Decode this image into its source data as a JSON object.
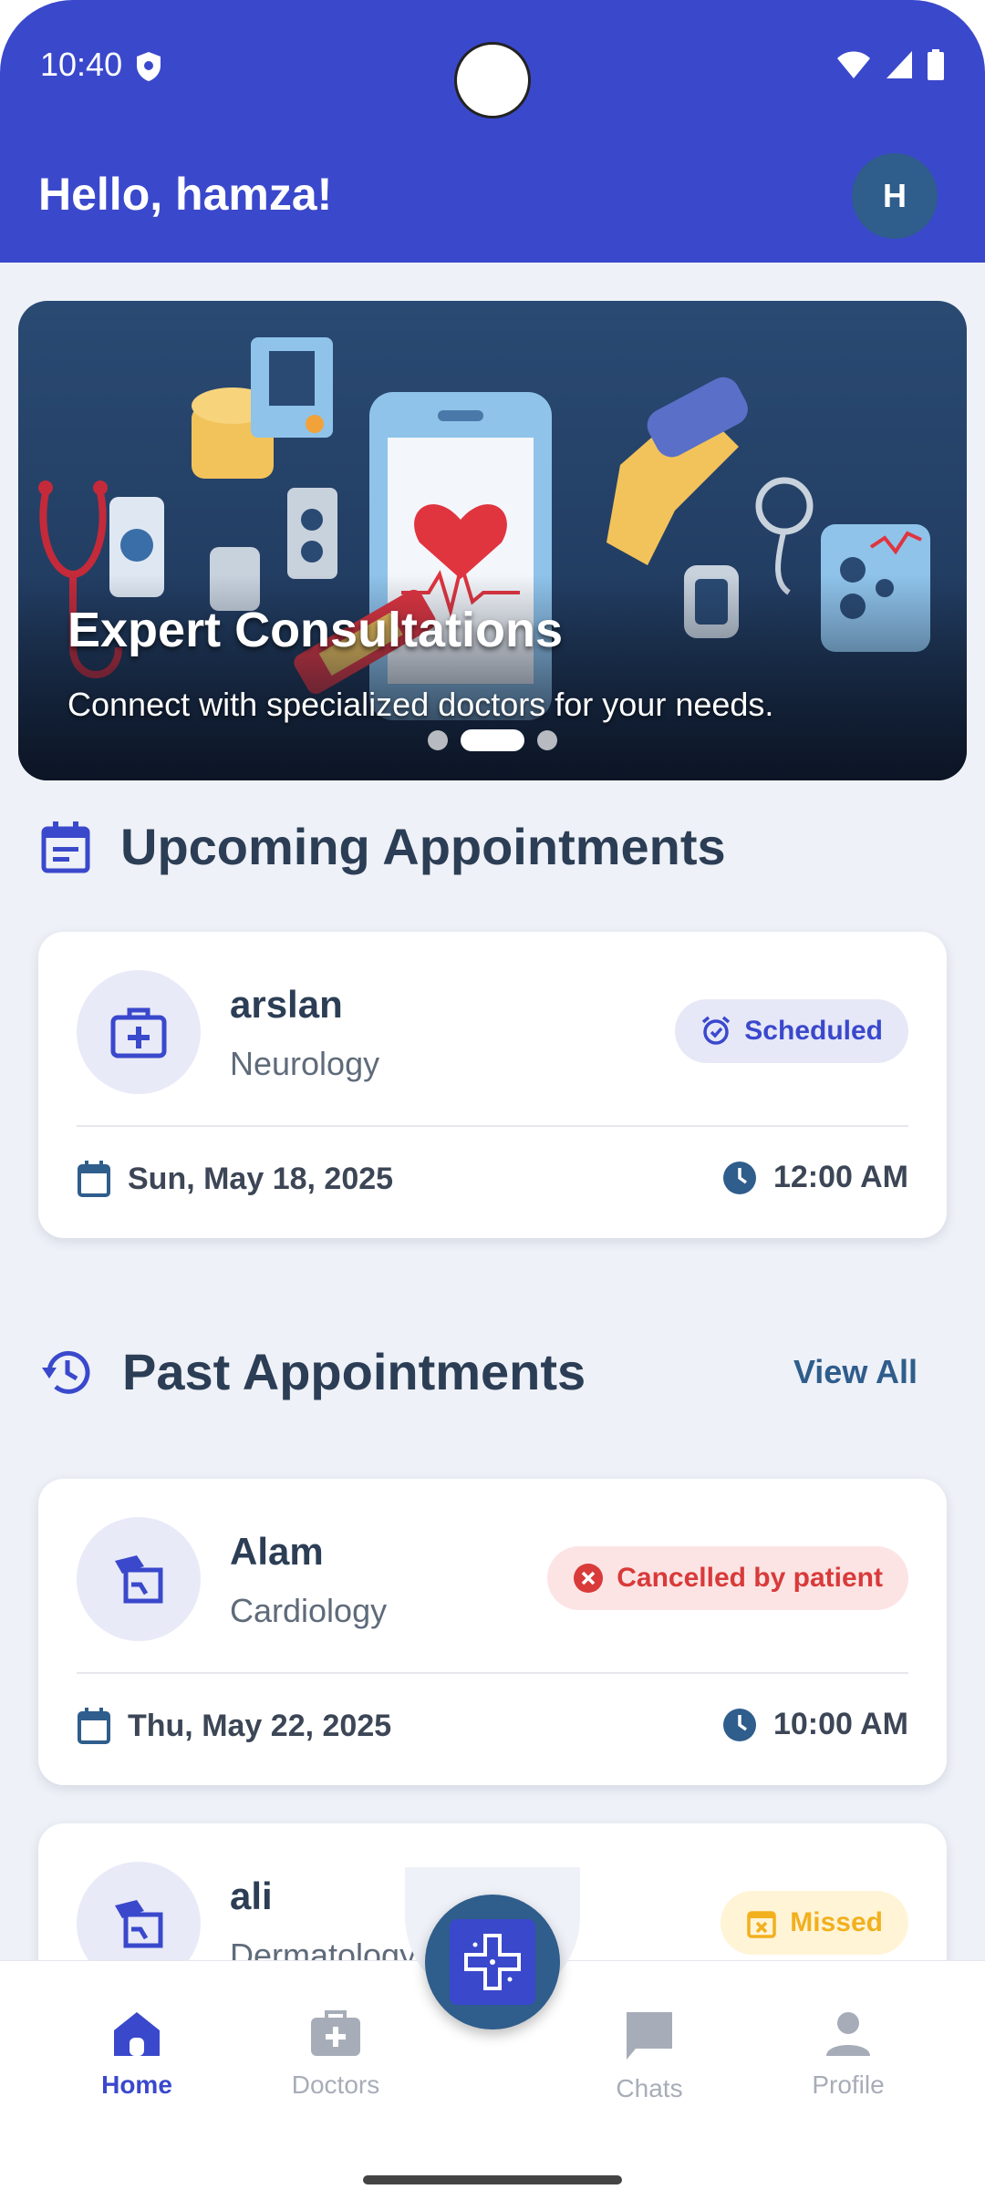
{
  "status_bar": {
    "time": "10:40"
  },
  "header": {
    "greeting": "Hello, hamza!",
    "avatar_initial": "H"
  },
  "banner": {
    "title": "Expert Consultations",
    "subtitle": "Connect with specialized doctors for your needs.",
    "active_slide": 2,
    "slide_count": 3
  },
  "upcoming": {
    "title": "Upcoming Appointments",
    "appointments": [
      {
        "doctor": "arslan",
        "specialty": "Neurology",
        "status": "Scheduled",
        "date": "Sun, May 18, 2025",
        "time": "12:00 AM"
      }
    ]
  },
  "past": {
    "title": "Past Appointments",
    "view_all": "View All",
    "appointments": [
      {
        "doctor": "Alam",
        "specialty": "Cardiology",
        "status": "Cancelled by patient",
        "date": "Thu, May 22, 2025",
        "time": "10:00 AM"
      },
      {
        "doctor": "ali",
        "specialty": "Dermatology",
        "status": "Missed"
      }
    ]
  },
  "bottom_nav": {
    "items": [
      {
        "label": "Home",
        "icon": "home-icon",
        "active": true
      },
      {
        "label": "Doctors",
        "icon": "medical-bag-icon",
        "active": false
      },
      {
        "label": "Chats",
        "icon": "chat-icon",
        "active": false
      },
      {
        "label": "Profile",
        "icon": "person-icon",
        "active": false
      }
    ]
  },
  "colors": {
    "primary": "#3a48cc",
    "secondary": "#2f5d8c",
    "scheduled": "#3a48cc",
    "cancelled": "#d93a3a",
    "missed": "#f2b01e"
  }
}
